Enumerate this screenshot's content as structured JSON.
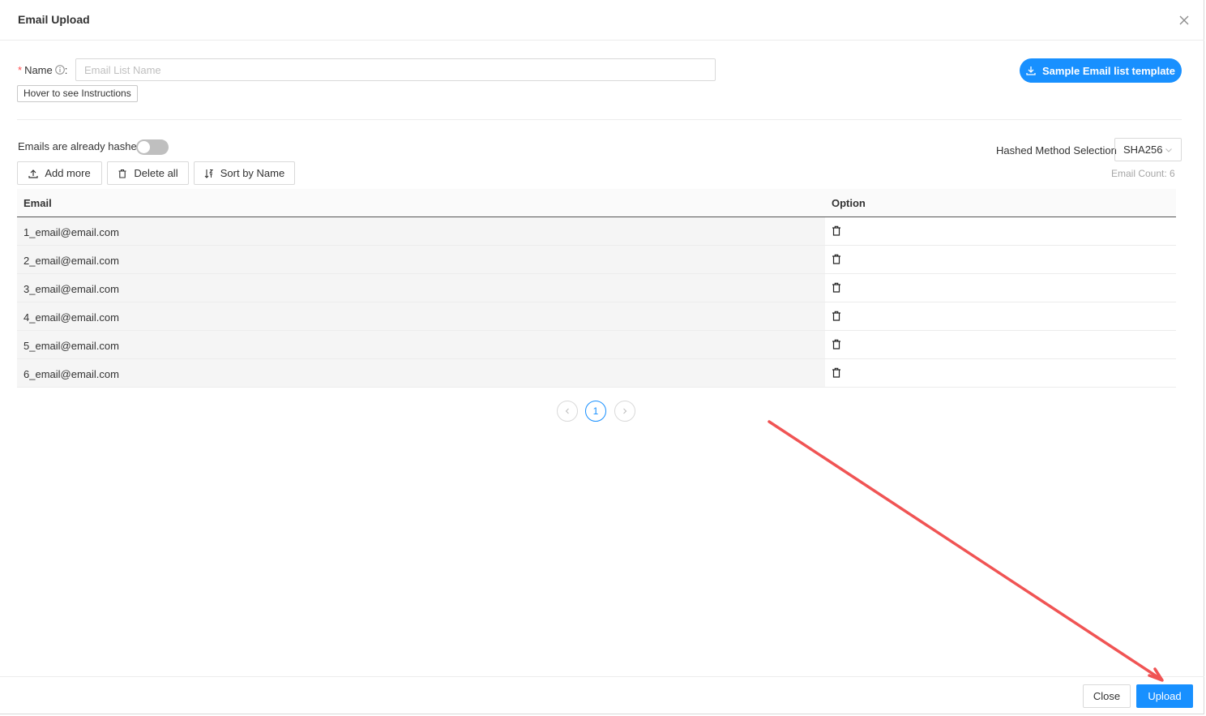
{
  "modal": {
    "title": "Email Upload",
    "close_icon": "close-icon"
  },
  "form": {
    "name_required_mark": "*",
    "name_label": "Name",
    "name_colon": ":",
    "name_placeholder": "Email List Name",
    "name_value": "",
    "hover_instructions": "Hover to see Instructions",
    "sample_button": "Sample Email list template"
  },
  "options": {
    "hashed_label": "Emails are already hashed",
    "hashed_enabled": false,
    "hash_method_label": "Hashed Method Selection",
    "hash_method_value": "SHA256",
    "add_more": "Add more",
    "delete_all": "Delete all",
    "sort_by_name": "Sort by Name",
    "email_count": "Email Count: 6"
  },
  "table": {
    "columns": [
      "Email",
      "Option"
    ],
    "rows": [
      {
        "email": "1_email@email.com"
      },
      {
        "email": "2_email@email.com"
      },
      {
        "email": "3_email@email.com"
      },
      {
        "email": "4_email@email.com"
      },
      {
        "email": "5_email@email.com"
      },
      {
        "email": "6_email@email.com"
      }
    ]
  },
  "pagination": {
    "current_page": "1"
  },
  "footer": {
    "close_label": "Close",
    "upload_label": "Upload"
  },
  "colors": {
    "primary": "#1890ff",
    "annotation_arrow": "#f05454",
    "required": "#ff4d4f"
  }
}
